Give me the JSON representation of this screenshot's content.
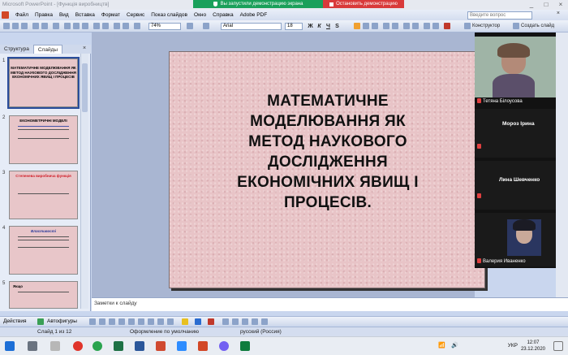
{
  "window": {
    "title": "Microsoft PowerPoint - [Функція виробництв]",
    "controls": [
      "_",
      "□",
      "×"
    ]
  },
  "share_banner": {
    "sharing_text": "Вы запустили демонстрацию экрана",
    "stop_text": "Остановить демонстрацию",
    "green": "#1aa05a",
    "red": "#d93a3a"
  },
  "menu": {
    "items": [
      "Файл",
      "Правка",
      "Вид",
      "Вставка",
      "Формат",
      "Сервис",
      "Показ слайдов",
      "Окно",
      "Справка",
      "Adobe PDF"
    ],
    "help_placeholder": "Введите вопрос",
    "close": "×"
  },
  "toolbar": {
    "zoom": "74%",
    "font": "Arial",
    "size": "18",
    "bold": "Ж",
    "italic": "К",
    "underline": "Ч",
    "shadow": "S",
    "constructor": "Конструктор",
    "new_slide": "Создать слайд"
  },
  "left_pane": {
    "tabs": [
      "Структура",
      "Слайды"
    ],
    "close": "×",
    "thumbnails": [
      {
        "num": "1",
        "title": "МАТЕМАТИЧНЕ МОДЕЛЮВАННЯ ЯК МЕТОД НАУКОВОГО ДОСЛІДЖЕННЯ ЕКОНОМІЧНИХ ЯВИЩ І ПРОЦЕСІВ"
      },
      {
        "num": "2",
        "title": "ЕКОНОМЕТРИЧНІ МОДЕЛІ"
      },
      {
        "num": "3",
        "title": "Степенева виробнича функція"
      },
      {
        "num": "4",
        "title": "Властивості"
      },
      {
        "num": "5",
        "title": "Якщо"
      }
    ]
  },
  "slide": {
    "title_lines": [
      "МАТЕМАТИЧНЕ",
      "МОДЕЛЮВАННЯ ЯК",
      "МЕТОД НАУКОВОГО",
      "ДОСЛІДЖЕННЯ",
      "ЕКОНОМІЧНИХ ЯВИЩ І",
      "ПРОЦЕСІВ."
    ]
  },
  "participants": [
    {
      "name": "Тетяна Білоусова",
      "video": true
    },
    {
      "name": "Мороз Ірина",
      "video": false
    },
    {
      "name": "Лина Шевченко",
      "video": false
    },
    {
      "name": "Валерия Иваненко",
      "video": true
    }
  ],
  "notes": {
    "placeholder": "Заметки к слайду"
  },
  "draw_toolbar": {
    "actions": "Действия",
    "autoshapes": "Автофигуры"
  },
  "status": {
    "slide": "Слайд 1 из 12",
    "design": "Оформление по умолчанию",
    "language": "русский (Россия)"
  },
  "taskbar": {
    "lang": "УКР",
    "time": "12:07",
    "date": "23.12.2020"
  }
}
